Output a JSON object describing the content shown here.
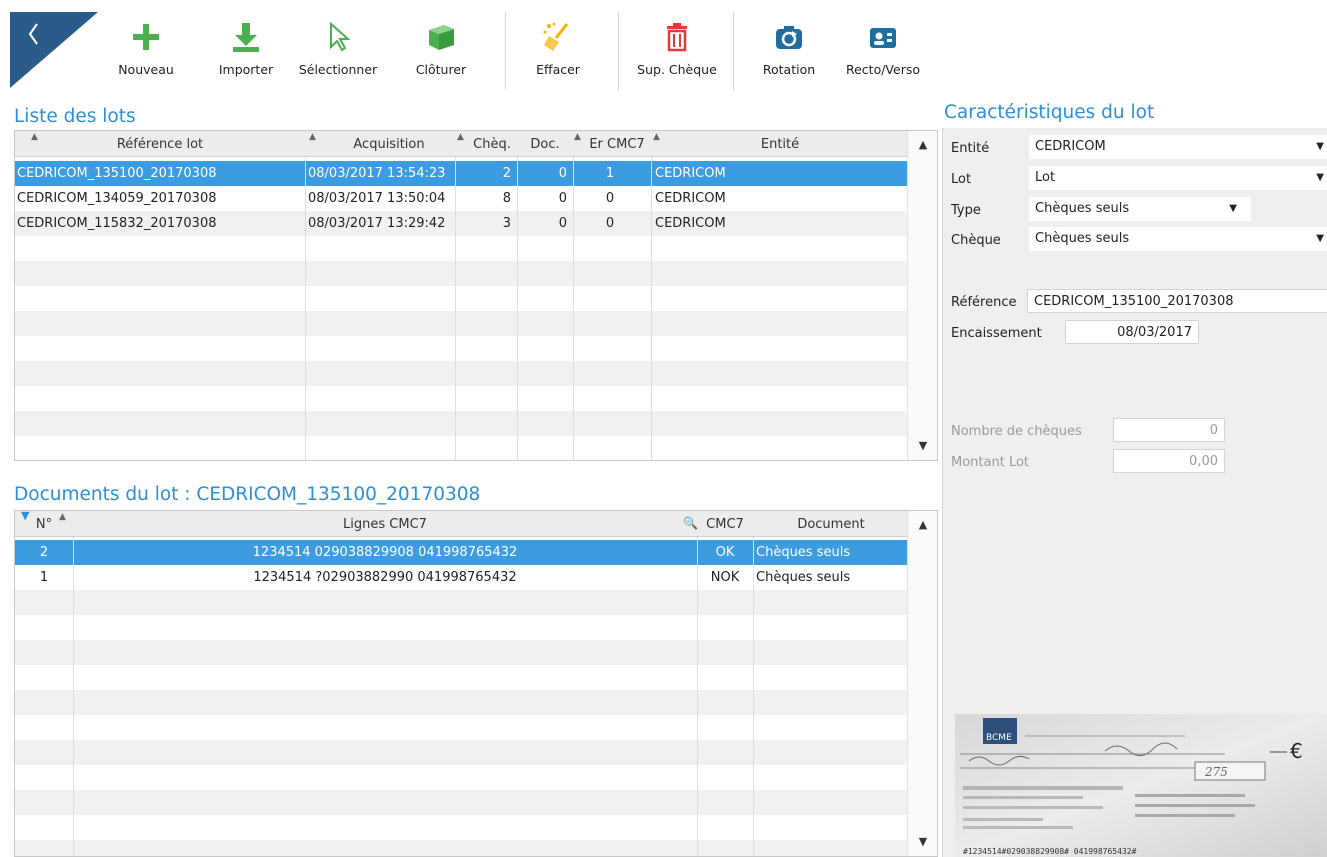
{
  "toolbar": {
    "items": [
      {
        "label": "Nouveau",
        "icon": "plus-icon"
      },
      {
        "label": "Importer",
        "icon": "download-icon"
      },
      {
        "label": "Sélectionner",
        "icon": "cursor-icon"
      },
      {
        "label": "Clôturer",
        "icon": "box-icon"
      },
      {
        "label": "Effacer",
        "icon": "broom-icon"
      },
      {
        "label": "Sup. Chèque",
        "icon": "trash-icon"
      },
      {
        "label": "Rotation",
        "icon": "rotate-camera-icon"
      },
      {
        "label": "Recto/Verso",
        "icon": "id-card-icon"
      }
    ]
  },
  "lots": {
    "title": "Liste des lots",
    "columns": [
      "Référence lot",
      "Acquisition",
      "Chèq.",
      "Doc.",
      "Er CMC7",
      "Entité"
    ],
    "rows": [
      {
        "ref": "CEDRICOM_135100_20170308",
        "acq": "08/03/2017 13:54:23",
        "cheq": "2",
        "doc": "0",
        "er": "1",
        "entite": "CEDRICOM",
        "selected": true
      },
      {
        "ref": "CEDRICOM_134059_20170308",
        "acq": "08/03/2017 13:50:04",
        "cheq": "8",
        "doc": "0",
        "er": "0",
        "entite": "CEDRICOM",
        "selected": false
      },
      {
        "ref": "CEDRICOM_115832_20170308",
        "acq": "08/03/2017 13:29:42",
        "cheq": "3",
        "doc": "0",
        "er": "0",
        "entite": "CEDRICOM",
        "selected": false
      }
    ]
  },
  "documents": {
    "title": "Documents du lot : CEDRICOM_135100_20170308",
    "columns": [
      "N°",
      "Lignes CMC7",
      "CMC7",
      "Document"
    ],
    "rows": [
      {
        "num": "2",
        "cmc7": "1234514 029038829908 041998765432",
        "status": "OK",
        "doc": "Chèques seuls",
        "selected": true
      },
      {
        "num": "1",
        "cmc7": "1234514 ?02903882990 041998765432",
        "status": "NOK",
        "doc": "Chèques seuls",
        "selected": false
      }
    ]
  },
  "details": {
    "title": "Caractéristiques du lot",
    "entite_label": "Entité",
    "entite_value": "CEDRICOM",
    "lot_label": "Lot",
    "lot_value": "Lot",
    "type_label": "Type",
    "type_value": "Chèques seuls",
    "cheque_label": "Chèque",
    "cheque_value": "Chèques seuls",
    "reference_label": "Référence",
    "reference_value": "CEDRICOM_135100_20170308",
    "encaissement_label": "Encaissement",
    "encaissement_value": "08/03/2017",
    "nb_cheques_label": "Nombre de chèques",
    "nb_cheques_value": "0",
    "montant_label": "Montant Lot",
    "montant_value": "0,00"
  },
  "cheque_preview": {
    "bank_logo": "BCME",
    "amount": "275",
    "currency": "€",
    "micr_line": "#1234514#029038829908# 041998765432#"
  },
  "colors": {
    "accent": "#2e8ed6",
    "selection": "#3d9be0",
    "nav_corner": "#2a5b8a"
  }
}
